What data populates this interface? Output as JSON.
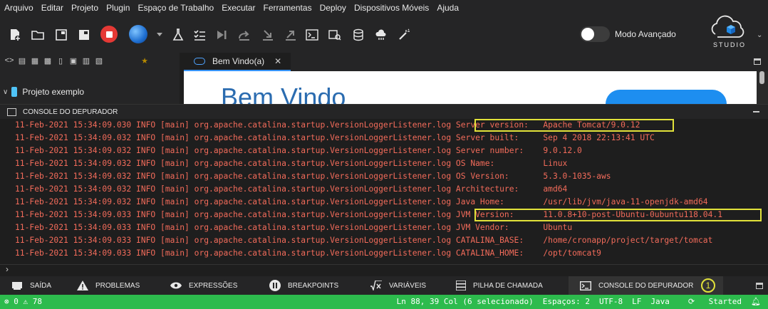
{
  "menu": [
    "Arquivo",
    "Editar",
    "Projeto",
    "Plugin",
    "Espaço de Trabalho",
    "Executar",
    "Ferramentas",
    "Deploy",
    "Dispositivos Móveis",
    "Ajuda"
  ],
  "toolbar": {
    "advanced_mode_label": "Modo Avançado",
    "logo_text": "STUDIO"
  },
  "project": {
    "label": "Projeto exemplo"
  },
  "editor": {
    "tab_label": "Bem Vindo(a)",
    "tab_close": "✕",
    "welcome_title": "Bem Vindo"
  },
  "console": {
    "title": "CONSOLE DO DEPURADOR",
    "prompt": "›",
    "lines": [
      {
        "prefix": "11-Feb-2021 15:34:09.030 INFO [main] org.apache.catalina.startup.VersionLoggerListener.log ",
        "message": "Server version:   Apache Tomcat/9.0.12"
      },
      {
        "prefix": "11-Feb-2021 15:34:09.032 INFO [main] org.apache.catalina.startup.VersionLoggerListener.log ",
        "message": "Server built:     Sep 4 2018 22:13:41 UTC"
      },
      {
        "prefix": "11-Feb-2021 15:34:09.032 INFO [main] org.apache.catalina.startup.VersionLoggerListener.log ",
        "message": "Server number:    9.0.12.0"
      },
      {
        "prefix": "11-Feb-2021 15:34:09.032 INFO [main] org.apache.catalina.startup.VersionLoggerListener.log ",
        "message": "OS Name:          Linux"
      },
      {
        "prefix": "11-Feb-2021 15:34:09.032 INFO [main] org.apache.catalina.startup.VersionLoggerListener.log ",
        "message": "OS Version:       5.3.0-1035-aws"
      },
      {
        "prefix": "11-Feb-2021 15:34:09.032 INFO [main] org.apache.catalina.startup.VersionLoggerListener.log ",
        "message": "Architecture:     amd64"
      },
      {
        "prefix": "11-Feb-2021 15:34:09.032 INFO [main] org.apache.catalina.startup.VersionLoggerListener.log ",
        "message": "Java Home:        /usr/lib/jvm/java-11-openjdk-amd64"
      },
      {
        "prefix": "11-Feb-2021 15:34:09.033 INFO [main] org.apache.catalina.startup.VersionLoggerListener.log ",
        "message": "JVM Version:      11.0.8+10-post-Ubuntu-0ubuntu118.04.1"
      },
      {
        "prefix": "11-Feb-2021 15:34:09.033 INFO [main] org.apache.catalina.startup.VersionLoggerListener.log ",
        "message": "JVM Vendor:       Ubuntu"
      },
      {
        "prefix": "11-Feb-2021 15:34:09.033 INFO [main] org.apache.catalina.startup.VersionLoggerListener.log ",
        "message": "CATALINA_BASE:    /home/cronapp/project/target/tomcat"
      },
      {
        "prefix": "11-Feb-2021 15:34:09.033 INFO [main] org.apache.catalina.startup.VersionLoggerListener.log ",
        "message": "CATALINA_HOME:    /opt/tomcat9"
      }
    ]
  },
  "bottom_tabs": {
    "saida": "SAÍDA",
    "problemas": "PROBLEMAS",
    "expressoes": "EXPRESSÕES",
    "breakpoints": "BREAKPOINTS",
    "variaveis": "VARIÁVEIS",
    "pilha": "PILHA DE CHAMADA",
    "console": "CONSOLE DO DEPURADOR",
    "marker": "1"
  },
  "status": {
    "errors": "0",
    "warnings": "78",
    "position": "Ln 88, 39 Col (6 selecionado)",
    "spaces": "Espaços: 2",
    "encoding": "UTF-8",
    "eol": "LF",
    "language": "Java",
    "server": "Started"
  },
  "colors": {
    "log_text": "#f26b5a",
    "highlight": "#e2e23a",
    "statusbar": "#2dbb4d",
    "accent": "#3794ff"
  }
}
